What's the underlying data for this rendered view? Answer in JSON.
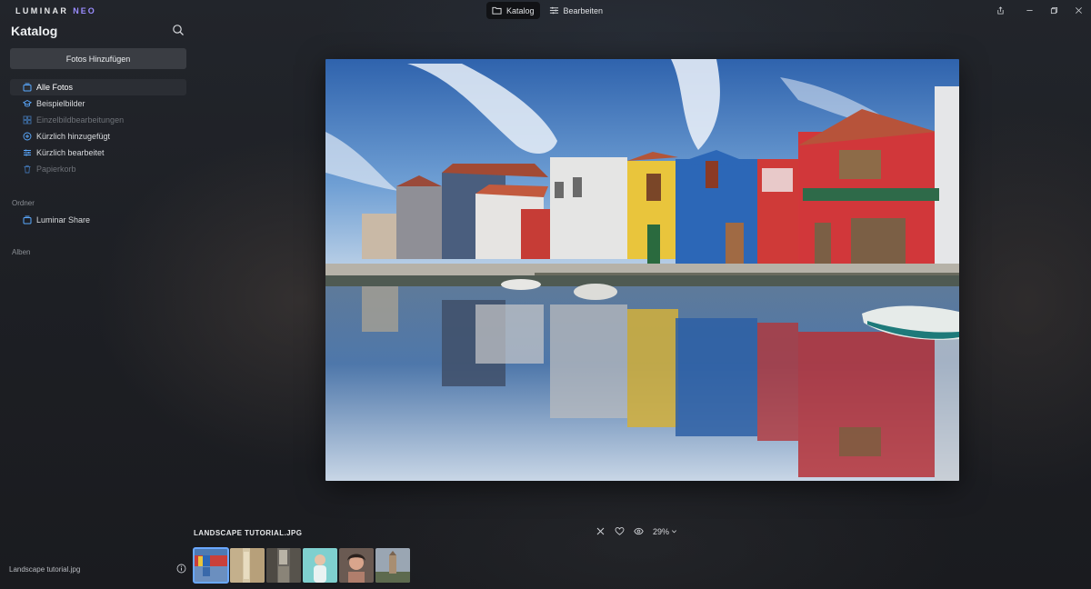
{
  "app": {
    "logo_main": "LUMINAR",
    "logo_accent": "NEO"
  },
  "modes": [
    {
      "label": "Katalog",
      "icon": "folder-icon",
      "active": true
    },
    {
      "label": "Bearbeiten",
      "icon": "sliders-icon",
      "active": false
    }
  ],
  "sidebar": {
    "title": "Katalog",
    "add_button": "Fotos Hinzufügen",
    "items": [
      {
        "label": "Alle Fotos",
        "icon": "photos-icon",
        "active": true
      },
      {
        "label": "Beispielbilder",
        "icon": "graduation-cap-icon"
      },
      {
        "label": "Einzelbildbearbeitungen",
        "icon": "grid-icon",
        "dim": true
      },
      {
        "label": "Kürzlich hinzugefügt",
        "icon": "plus-circle-icon"
      },
      {
        "label": "Kürzlich bearbeitet",
        "icon": "sliders-icon"
      },
      {
        "label": "Papierkorb",
        "icon": "trash-icon",
        "dim": true
      }
    ],
    "folders_label": "Ordner",
    "folders": [
      {
        "label": "Luminar Share",
        "icon": "photos-icon"
      }
    ],
    "albums_label": "Alben",
    "footer_text": "Landscape tutorial.jpg"
  },
  "viewer": {
    "filename": "LANDSCAPE TUTORIAL.JPG",
    "zoom": "29%"
  },
  "filmstrip": [
    {
      "name": "canal-houses",
      "selected": true
    },
    {
      "name": "street-beige"
    },
    {
      "name": "city-street"
    },
    {
      "name": "portrait-teal"
    },
    {
      "name": "portrait-woman"
    },
    {
      "name": "tower-landscape"
    }
  ]
}
